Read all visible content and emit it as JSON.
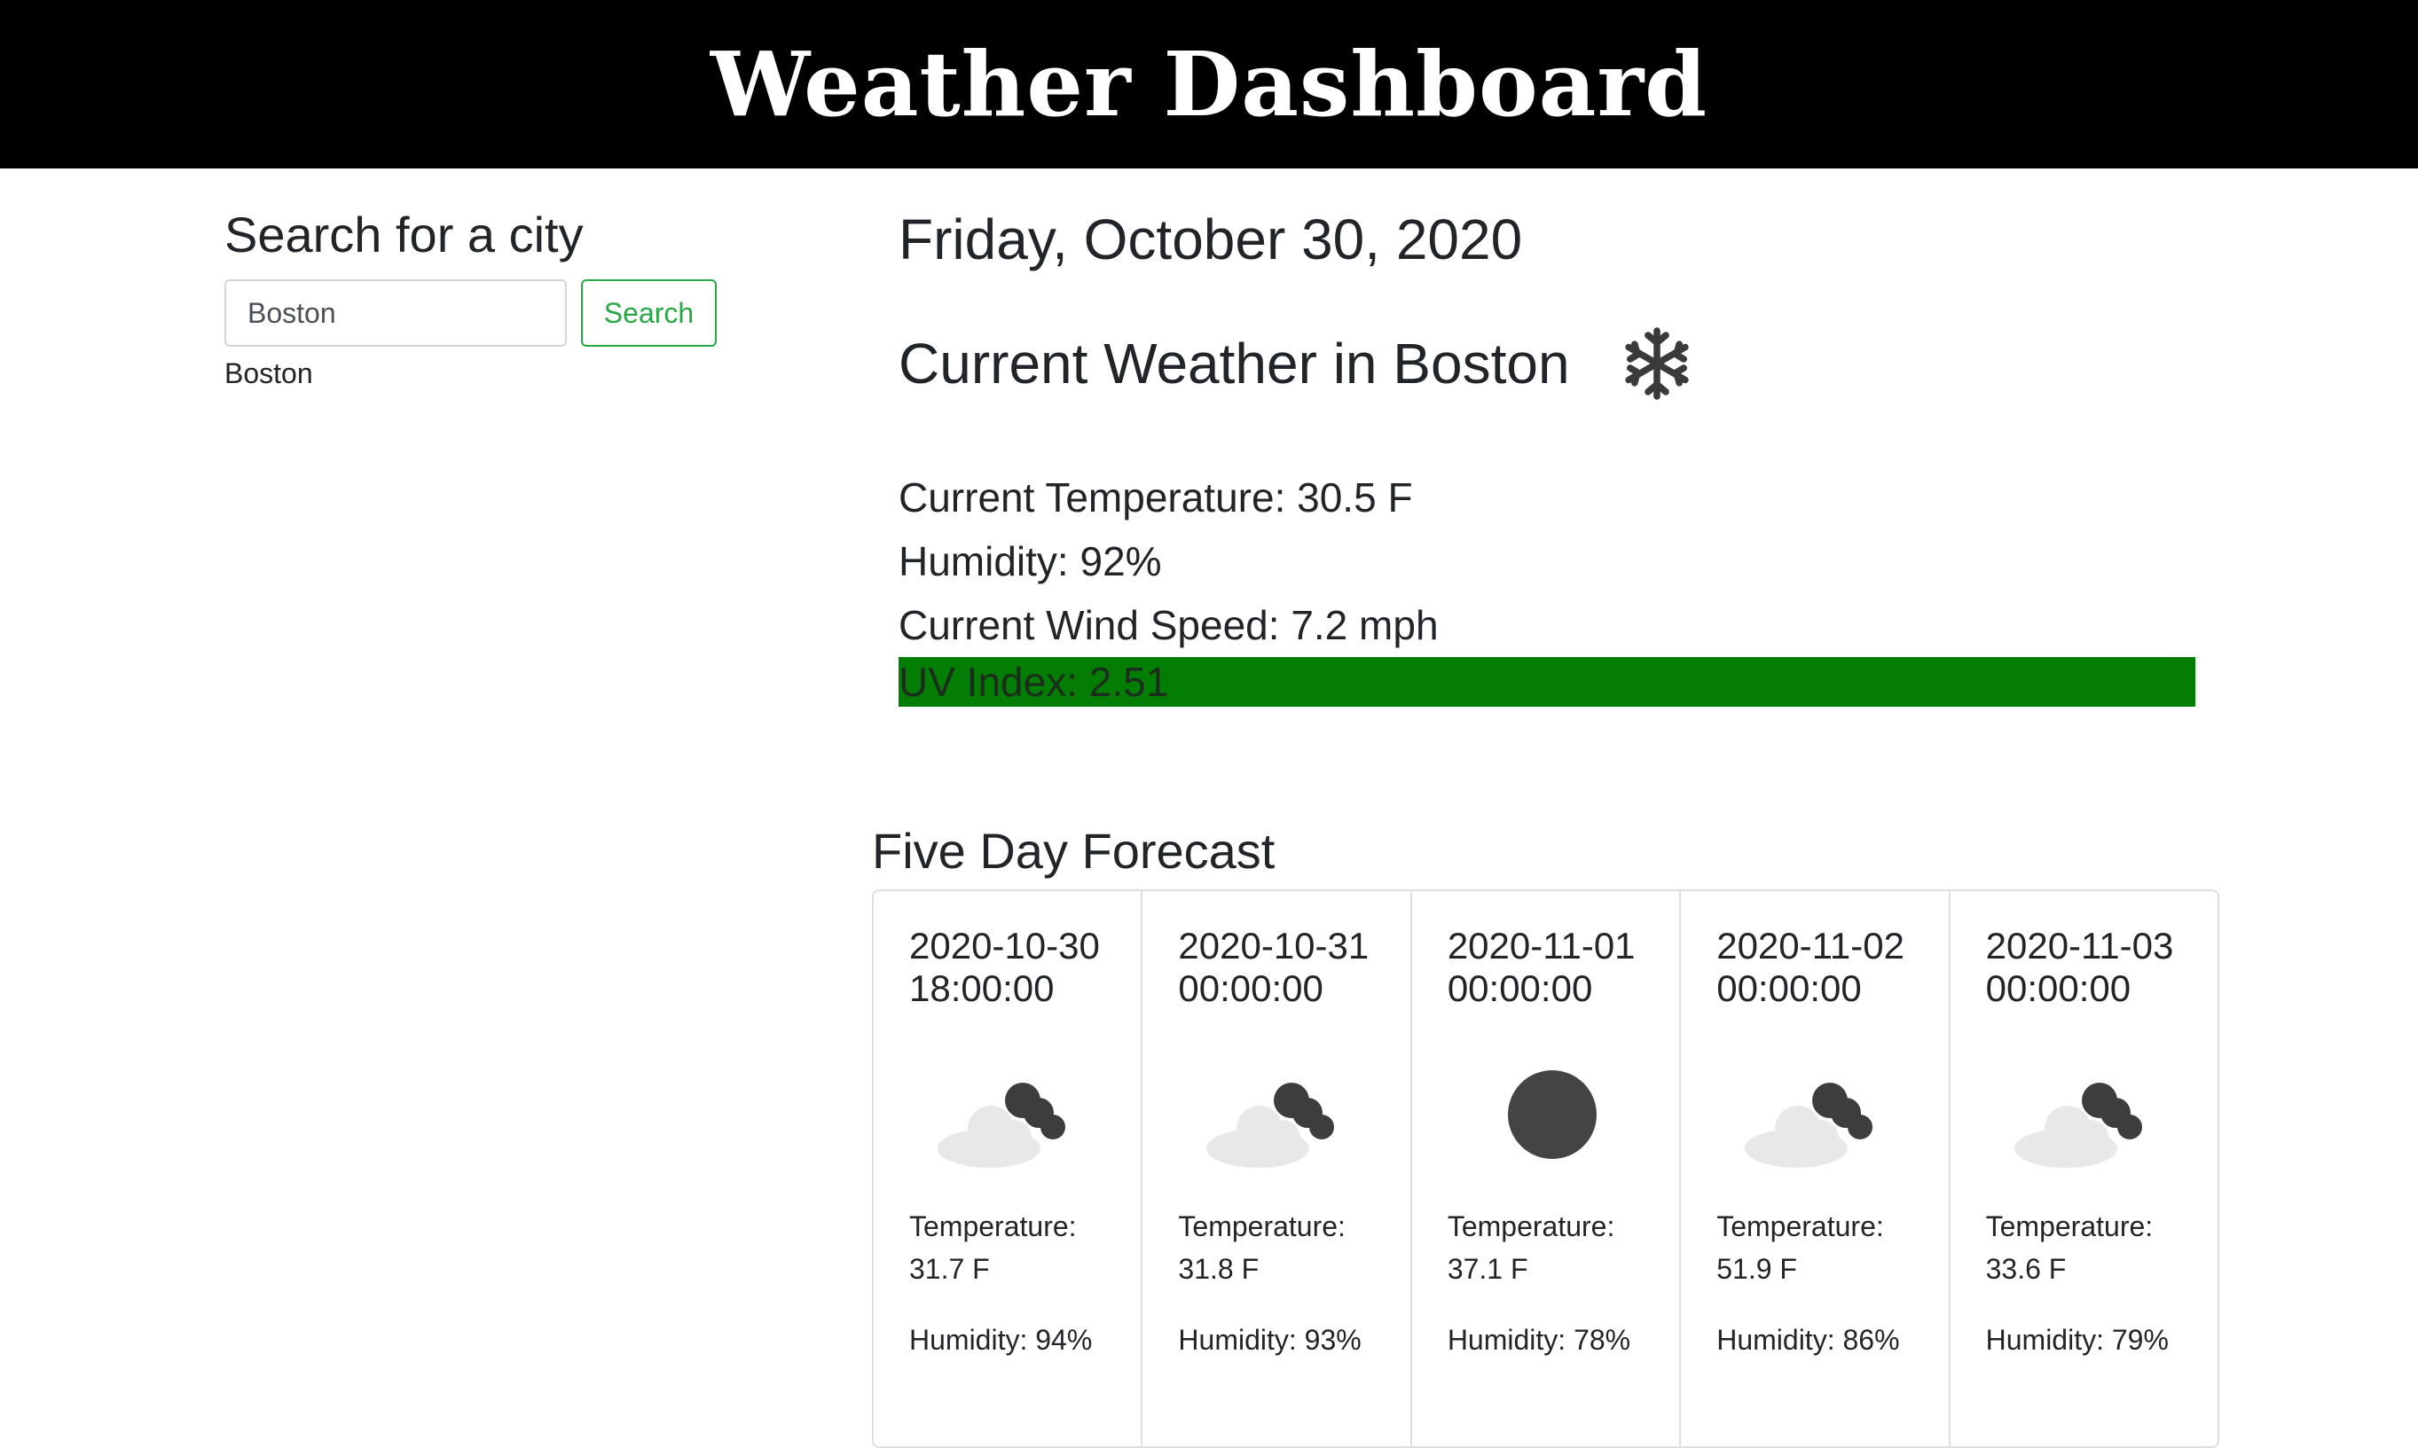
{
  "header": {
    "title": "Weather Dashboard"
  },
  "sidebar": {
    "heading": "Search for a city",
    "search_value": "Boston",
    "search_button": "Search",
    "history": [
      "Boston"
    ]
  },
  "current": {
    "date": "Friday, October 30, 2020",
    "title": "Current Weather in Boston",
    "icon": "snowflake-icon",
    "temperature": "Current Temperature: 30.5 F",
    "humidity": "Humidity: 92%",
    "wind": "Current Wind Speed: 7.2 mph",
    "uv": "UV Index: 2.51",
    "uv_color": "#047d04"
  },
  "forecast": {
    "title": "Five Day Forecast",
    "days": [
      {
        "date": "2020-10-30 18:00:00",
        "icon": "cloudy-night-icon",
        "temp_label": "Temperature:",
        "temp": "31.7 F",
        "humidity": "Humidity: 94%"
      },
      {
        "date": "2020-10-31 00:00:00",
        "icon": "cloudy-night-icon",
        "temp_label": "Temperature:",
        "temp": "31.8 F",
        "humidity": "Humidity: 93%"
      },
      {
        "date": "2020-11-01 00:00:00",
        "icon": "clear-night-icon",
        "temp_label": "Temperature:",
        "temp": "37.1 F",
        "humidity": "Humidity: 78%"
      },
      {
        "date": "2020-11-02 00:00:00",
        "icon": "cloudy-night-icon",
        "temp_label": "Temperature:",
        "temp": "51.9 F",
        "humidity": "Humidity: 86%"
      },
      {
        "date": "2020-11-03 00:00:00",
        "icon": "cloudy-night-icon",
        "temp_label": "Temperature:",
        "temp": "33.6 F",
        "humidity": "Humidity: 79%"
      }
    ]
  }
}
